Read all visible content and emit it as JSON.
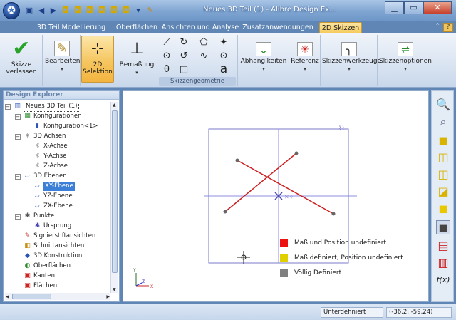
{
  "window": {
    "title": "Neues 3D Teil (1) - Alibre Design Ex...",
    "app_icon": "alibre-orb-icon",
    "minimize": "▁",
    "maximize": "▭",
    "close": "✕"
  },
  "quick_access": [
    "save-icon",
    "undo-icon",
    "redo-icon",
    "cube-icon",
    "cube-icon",
    "cube-icon",
    "cube-icon",
    "cube-icon",
    "cube-icon",
    "dropdown-icon",
    "pencil-icon"
  ],
  "ribbon_tabs": [
    {
      "label": "3D Teil Modellierung",
      "active": false
    },
    {
      "label": "Oberflächen",
      "active": false
    },
    {
      "label": "Ansichten und Analyse",
      "active": false
    },
    {
      "label": "Zusatzanwendungen",
      "active": false
    },
    {
      "label": "2D Skizzen",
      "active": true
    }
  ],
  "help_label": "?",
  "ribbon": {
    "skizze_verlassen": "Skizze verlassen",
    "bearbeiten": "Bearbeiten",
    "selektion_2d": "2D Selektion",
    "bemassung": "Bemaßung",
    "skizzengeometrie": "Skizzengeometrie",
    "abhaengigkeiten": "Abhängikeiten",
    "referenz": "Referenz",
    "skizzenwerkzeuge": "Skizzenwerkzeuge",
    "skizzenoptionen": "Skizzenoptionen",
    "text_tool_glyph": "a"
  },
  "explorer": {
    "title": "Design Explorer",
    "nodes": [
      {
        "label": "Neues 3D Teil (1)",
        "level": 0,
        "expander": "−",
        "icon": "part-icon"
      },
      {
        "label": "Konfigurationen",
        "level": 1,
        "expander": "−",
        "icon": "configurations-icon"
      },
      {
        "label": "Konfiguration<1>",
        "level": 2,
        "expander": "",
        "icon": "configuration-icon"
      },
      {
        "label": "3D Achsen",
        "level": 1,
        "expander": "−",
        "icon": "axes-icon"
      },
      {
        "label": "X-Achse",
        "level": 2,
        "expander": "",
        "icon": "axis-icon"
      },
      {
        "label": "Y-Achse",
        "level": 2,
        "expander": "",
        "icon": "axis-icon"
      },
      {
        "label": "Z-Achse",
        "level": 2,
        "expander": "",
        "icon": "axis-icon"
      },
      {
        "label": "3D Ebenen",
        "level": 1,
        "expander": "−",
        "icon": "planes-icon"
      },
      {
        "label": "XY-Ebene",
        "level": 2,
        "expander": "",
        "icon": "plane-icon",
        "selected": true
      },
      {
        "label": "YZ-Ebene",
        "level": 2,
        "expander": "",
        "icon": "plane-icon"
      },
      {
        "label": "ZX-Ebene",
        "level": 2,
        "expander": "",
        "icon": "plane-icon"
      },
      {
        "label": "Punkte",
        "level": 1,
        "expander": "−",
        "icon": "points-icon"
      },
      {
        "label": "Ursprung",
        "level": 2,
        "expander": "",
        "icon": "origin-icon"
      },
      {
        "label": "Signierstiftansichten",
        "level": 1,
        "expander": "",
        "icon": "redline-icon"
      },
      {
        "label": "Schnittansichten",
        "level": 1,
        "expander": "",
        "icon": "section-icon"
      },
      {
        "label": "3D Konstruktion",
        "level": 1,
        "expander": "",
        "icon": "construction-icon"
      },
      {
        "label": "Oberflächen",
        "level": 1,
        "expander": "",
        "icon": "surfaces-icon"
      },
      {
        "label": "Kanten",
        "level": 1,
        "expander": "",
        "icon": "edges-icon"
      },
      {
        "label": "Flächen",
        "level": 1,
        "expander": "",
        "icon": "faces-icon"
      }
    ]
  },
  "legend": [
    {
      "label": "Maß und Position undefiniert",
      "color": "#ee1111"
    },
    {
      "label": "Maß definiert, Position undefiniert",
      "color": "#e0d000"
    },
    {
      "label": "Völlig Definiert",
      "color": "#808080"
    }
  ],
  "axis_triad": {
    "y": "Y",
    "z": "Z",
    "x": "X"
  },
  "right_toolbar": [
    "zoom-icon",
    "zoom-window-icon",
    "cube-front-icon",
    "cube-top-icon",
    "cube-side-icon",
    "cube-iso-icon",
    "cube-yellow-icon",
    "cube-dark-icon",
    "pdf-icon",
    "export-icon",
    "function-icon"
  ],
  "function_label": "f(x)",
  "status": {
    "state": "Unterdefiniert",
    "coords": "(-36,2, -59,24)"
  },
  "colors": {
    "sketch_line": "#cc2020",
    "sketch_point": "#666666",
    "plane_border": "#7a7ac8",
    "axis_line": "#8c8ce0",
    "selection_highlight": "#f5c660"
  }
}
